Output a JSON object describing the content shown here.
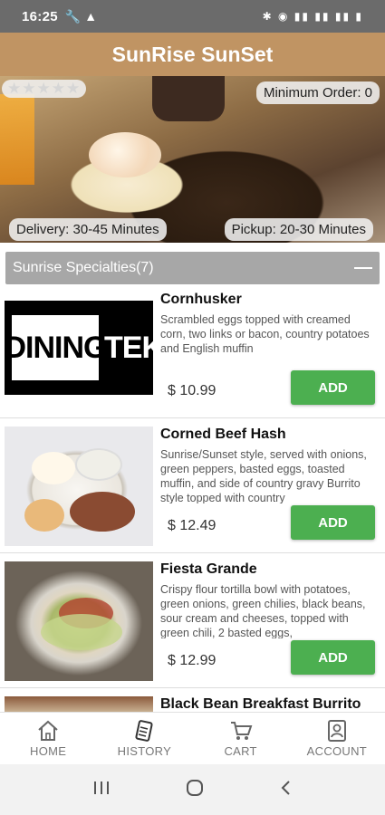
{
  "status_bar": {
    "time": "16:25"
  },
  "header": {
    "title": "SunRise SunSet"
  },
  "restaurant": {
    "stars": "★★★★★",
    "min_order": "Minimum Order: 0",
    "delivery": "Delivery: 30-45 Minutes",
    "pickup": "Pickup: 20-30 Minutes"
  },
  "section": {
    "title": "Sunrise Specialties(7)"
  },
  "items": [
    {
      "name": "Cornhusker",
      "description": "Scrambled eggs topped with creamed corn, two links or bacon, country potatoes and English muffin",
      "price": "$ 10.99",
      "add_label": "ADD",
      "logo_left": "DINING",
      "logo_right": "TEK"
    },
    {
      "name": "Corned Beef Hash",
      "description": "Sunrise/Sunset style, served with onions, green peppers, basted eggs, toasted muffin, and side of country gravy Burrito style topped with country",
      "price": "$ 12.49",
      "add_label": "ADD"
    },
    {
      "name": "Fiesta Grande",
      "description": "Crispy flour tortilla bowl with potatoes, green onions, green chilies, black beans, sour cream and cheeses, topped with green chili, 2 basted eggs,",
      "price": "$ 12.99",
      "add_label": "ADD"
    },
    {
      "name": "Black Bean Breakfast Burrito"
    }
  ],
  "bottom_nav": [
    {
      "label": "HOME",
      "icon": "home-icon"
    },
    {
      "label": "HISTORY",
      "icon": "history-icon"
    },
    {
      "label": "CART",
      "icon": "cart-icon"
    },
    {
      "label": "ACCOUNT",
      "icon": "account-icon"
    }
  ],
  "colors": {
    "header": "#c09463",
    "add_button": "#4caf50",
    "section_header": "#a7a7a7"
  }
}
